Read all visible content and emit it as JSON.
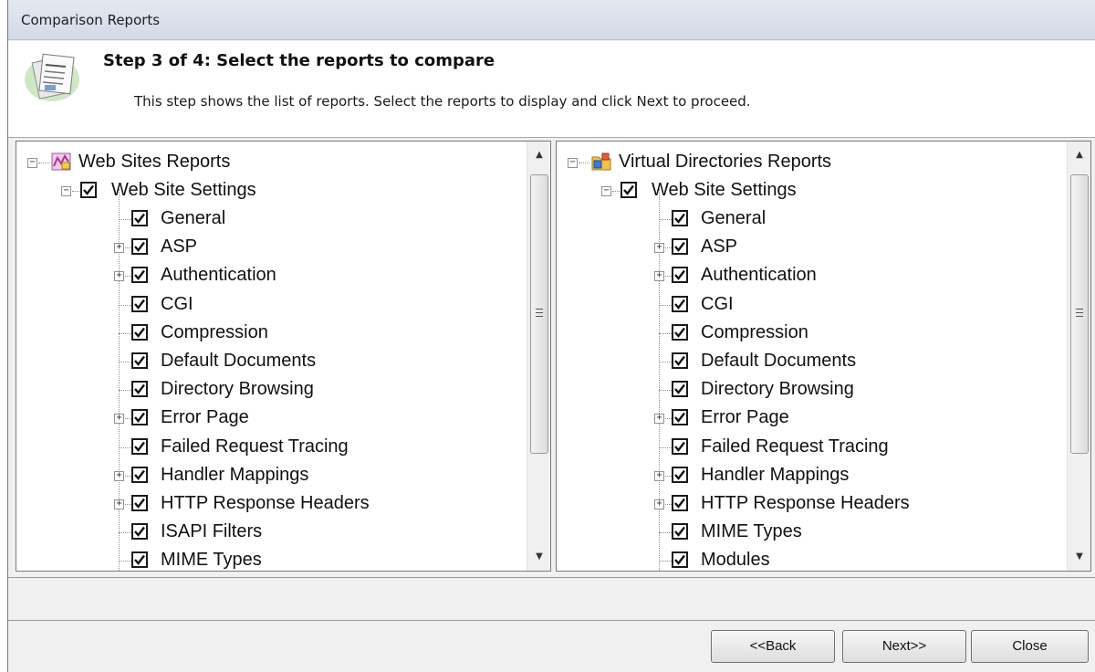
{
  "window": {
    "title": "Comparison Reports"
  },
  "header": {
    "step_title": "Step 3  of 4: Select the reports to compare",
    "step_desc": "This step shows the list of reports. Select the reports to display and click Next to proceed."
  },
  "left_tree": {
    "root_label": "Web Sites Reports",
    "group_label": "Web Site Settings",
    "items": [
      {
        "label": "General",
        "expandable": false,
        "checked": true
      },
      {
        "label": "ASP",
        "expandable": true,
        "checked": true
      },
      {
        "label": "Authentication",
        "expandable": true,
        "checked": true
      },
      {
        "label": "CGI",
        "expandable": false,
        "checked": true
      },
      {
        "label": "Compression",
        "expandable": false,
        "checked": true
      },
      {
        "label": "Default Documents",
        "expandable": false,
        "checked": true
      },
      {
        "label": "Directory Browsing",
        "expandable": false,
        "checked": true
      },
      {
        "label": "Error Page",
        "expandable": true,
        "checked": true
      },
      {
        "label": "Failed Request Tracing",
        "expandable": false,
        "checked": true
      },
      {
        "label": "Handler Mappings",
        "expandable": true,
        "checked": true
      },
      {
        "label": "HTTP Response Headers",
        "expandable": true,
        "checked": true
      },
      {
        "label": "ISAPI Filters",
        "expandable": false,
        "checked": true
      },
      {
        "label": "MIME Types",
        "expandable": false,
        "checked": true
      }
    ]
  },
  "right_tree": {
    "root_label": "Virtual Directories Reports",
    "group_label": "Web Site Settings",
    "items": [
      {
        "label": "General",
        "expandable": false,
        "checked": true
      },
      {
        "label": "ASP",
        "expandable": true,
        "checked": true
      },
      {
        "label": "Authentication",
        "expandable": true,
        "checked": true
      },
      {
        "label": "CGI",
        "expandable": false,
        "checked": true
      },
      {
        "label": "Compression",
        "expandable": false,
        "checked": true
      },
      {
        "label": "Default Documents",
        "expandable": false,
        "checked": true
      },
      {
        "label": "Directory Browsing",
        "expandable": false,
        "checked": true
      },
      {
        "label": "Error Page",
        "expandable": true,
        "checked": true
      },
      {
        "label": "Failed Request Tracing",
        "expandable": false,
        "checked": true
      },
      {
        "label": "Handler Mappings",
        "expandable": true,
        "checked": true
      },
      {
        "label": "HTTP Response Headers",
        "expandable": true,
        "checked": true
      },
      {
        "label": "MIME Types",
        "expandable": false,
        "checked": true
      },
      {
        "label": "Modules",
        "expandable": false,
        "checked": true
      }
    ]
  },
  "buttons": {
    "back": "<<Back",
    "next": "Next>>",
    "close": "Close"
  },
  "icons": {
    "left_root": "web-sites-icon",
    "right_root": "virtual-directory-icon",
    "header": "report-pages-icon"
  },
  "colors": {
    "title_bar": "#dde3ec",
    "panel_border": "#7a7a7a"
  }
}
